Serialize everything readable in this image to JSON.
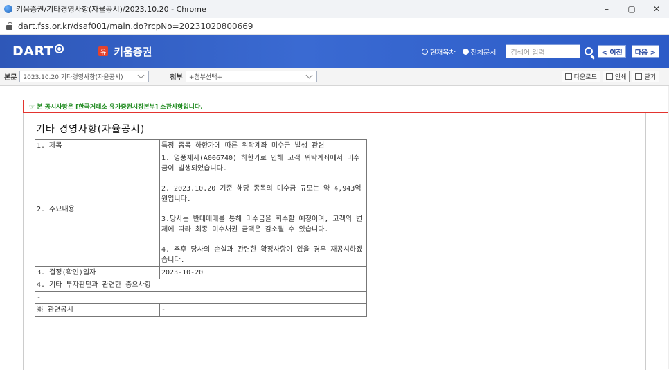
{
  "browser": {
    "tab_title": "키움증권/기타경영사항(자율공시)/2023.10.20 - Chrome",
    "url": "dart.fss.or.kr/dsaf001/main.do?rcpNo=20231020800669",
    "minimize": "–",
    "maximize": "▢",
    "close": "✕"
  },
  "header": {
    "logo_text": "DART",
    "company_badge": "유",
    "company_name": "키움증권",
    "radio_current": "현재목차",
    "radio_all": "전체문서",
    "search_placeholder": "검색어 입력",
    "prev_label": "< 이전",
    "next_label": "다음 >"
  },
  "toolbar": {
    "body_label": "본문",
    "body_select": "2023.10.20  기타경영사항(자율공시)",
    "attach_label": "첨부",
    "attach_select": "+첨부선택+",
    "download_label": "다운로드",
    "print_label": "인쇄",
    "close_label": "닫기"
  },
  "notice": "☞ 본 공시사항은 [한국거래소 유가증권시장본부] 소관사항입니다.",
  "document": {
    "title": "기타 경영사항(자율공시)",
    "rows": {
      "r1_label": "1. 제목",
      "r1_value": "특정 종목 하한가에 따른 위탁계좌 미수금 발생 관련",
      "r2_label": "2. 주요내용",
      "r2_p1": "1. 영풍제지(A006740) 하한가로 인해 고객 위탁계좌에서 미수금이 발생되었습니다.",
      "r2_p2": "2. 2023.10.20 기준 해당 종목의 미수금 규모는 약 4,943억원입니다.",
      "r2_p3": "3.당사는 반대매매를 통해 미수금을 회수할 예정이며, 고객의 변제에 따라 최종 미수채권 금액은 감소될 수 있습니다.",
      "r2_p4": "4. 추후 당사의 손실과 관련한 확정사항이 있을 경우 재공시하겠습니다.",
      "r3_label": "3. 결정(확인)일자",
      "r3_value": "2023-10-20",
      "r4_label": "4. 기타 투자판단과 관련한 중요사항",
      "r5_value": "-",
      "r6_label": "※ 관련공시",
      "r6_value": "-"
    }
  }
}
